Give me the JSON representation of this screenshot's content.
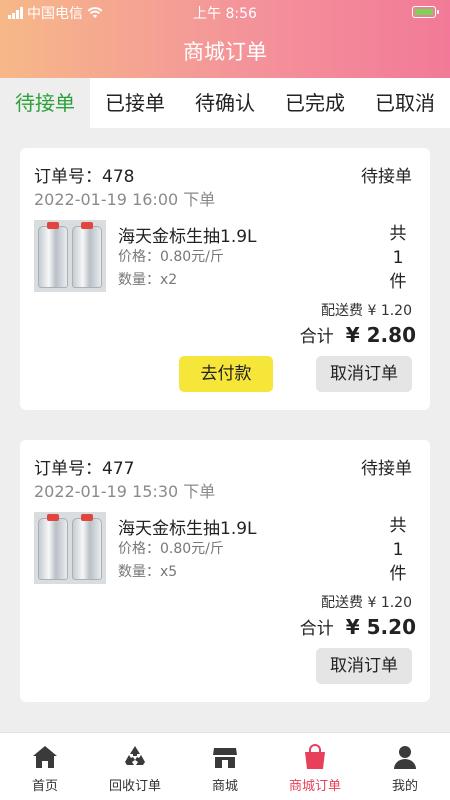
{
  "status_bar": {
    "carrier": "中国电信",
    "time": "上午 8:56"
  },
  "header": {
    "title": "商城订单"
  },
  "tabs": [
    {
      "label": "待接单",
      "active": true
    },
    {
      "label": "已接单",
      "active": false
    },
    {
      "label": "待确认",
      "active": false
    },
    {
      "label": "已完成",
      "active": false
    },
    {
      "label": "已取消",
      "active": false
    }
  ],
  "orders": [
    {
      "order_no": "订单号：478",
      "status": "待接单",
      "time": "2022-01-19 16:00 下单",
      "product_name": "海天金标生抽1.9L",
      "price": "价格：0.80元/斤",
      "qty": "数量：x2",
      "count_prefix": "共",
      "count": "1",
      "count_suffix": "件",
      "delivery_fee": "配送费 ¥ 1.20",
      "total_label": "合计",
      "total_value": "¥ 2.80",
      "pay_label": "去付款",
      "cancel_label": "取消订单"
    },
    {
      "order_no": "订单号：477",
      "status": "待接单",
      "time": "2022-01-19 15:30 下单",
      "product_name": "海天金标生抽1.9L",
      "price": "价格：0.80元/斤",
      "qty": "数量：x5",
      "count_prefix": "共",
      "count": "1",
      "count_suffix": "件",
      "delivery_fee": "配送费 ¥ 1.20",
      "total_label": "合计",
      "total_value": "¥ 5.20",
      "cancel_label": "取消订单"
    }
  ],
  "bottom_nav": [
    {
      "label": "首页",
      "icon": "home-icon"
    },
    {
      "label": "回收订单",
      "icon": "recycle-icon"
    },
    {
      "label": "商城",
      "icon": "store-icon"
    },
    {
      "label": "商城订单",
      "icon": "shopping-bag-icon",
      "active": true
    },
    {
      "label": "我的",
      "icon": "user-icon"
    }
  ],
  "colors": {
    "accent_green": "#2aa13a",
    "active_nav": "#e8405a",
    "pay_button": "#f6e63a"
  }
}
